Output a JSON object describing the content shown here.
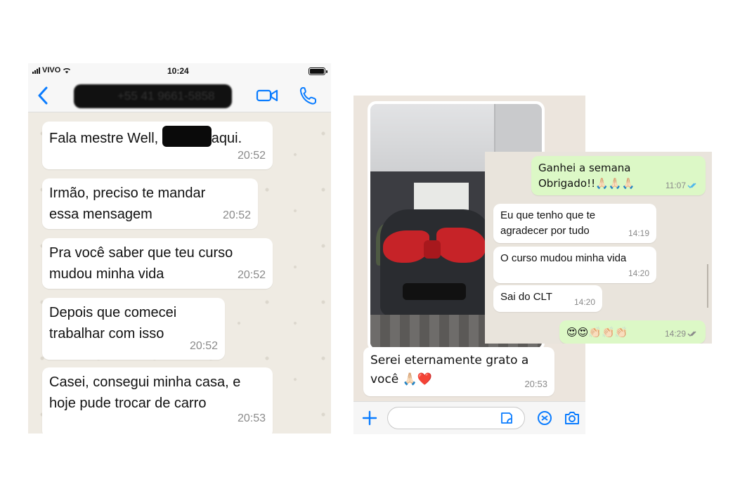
{
  "left_chat": {
    "status": {
      "carrier": "VIVO",
      "time": "10:24"
    },
    "header": {
      "contact_name": "+55 41 9661-5858"
    },
    "messages": [
      {
        "text_before": "Fala mestre Well,",
        "text_after": "aqui.",
        "time": "20:52"
      },
      {
        "text": "Irmão, preciso te mandar essa mensagem",
        "time": "20:52"
      },
      {
        "text": "Pra você saber que teu curso mudou minha vida",
        "time": "20:52"
      },
      {
        "text": "Depois que comecei trabalhar com isso",
        "time": "20:52"
      },
      {
        "text": "Casei, consegui minha casa, e hoje pude trocar de carro",
        "time": "20:53"
      }
    ]
  },
  "right_chat": {
    "messages": [
      {
        "text": "Serei eternamente grato a você 🙏🏻❤️",
        "time": "20:53"
      }
    ],
    "composer": {
      "placeholder": ""
    }
  },
  "overlay_chat": {
    "messages": [
      {
        "direction": "out",
        "text": "Ganhei a semana Obrigado!!🙏🏻🙏🏻🙏🏻",
        "time": "11:07"
      },
      {
        "direction": "in",
        "text": "Eu que tenho que te agradecer por tudo",
        "time": "14:19"
      },
      {
        "direction": "in",
        "text": "O curso mudou minha vida",
        "time": "14:20"
      },
      {
        "direction": "in",
        "text": "Sai do CLT",
        "time": "14:20"
      },
      {
        "direction": "out",
        "text": "😍😍👏🏻👏🏻👏🏻",
        "time": "14:29"
      }
    ]
  },
  "colors": {
    "ios_blue": "#0a7cff",
    "outgoing_bubble": "#dcf8c6",
    "incoming_bubble": "#ffffff",
    "wallpaper": "#efebe3",
    "read_ticks": "#4fb6ec"
  }
}
